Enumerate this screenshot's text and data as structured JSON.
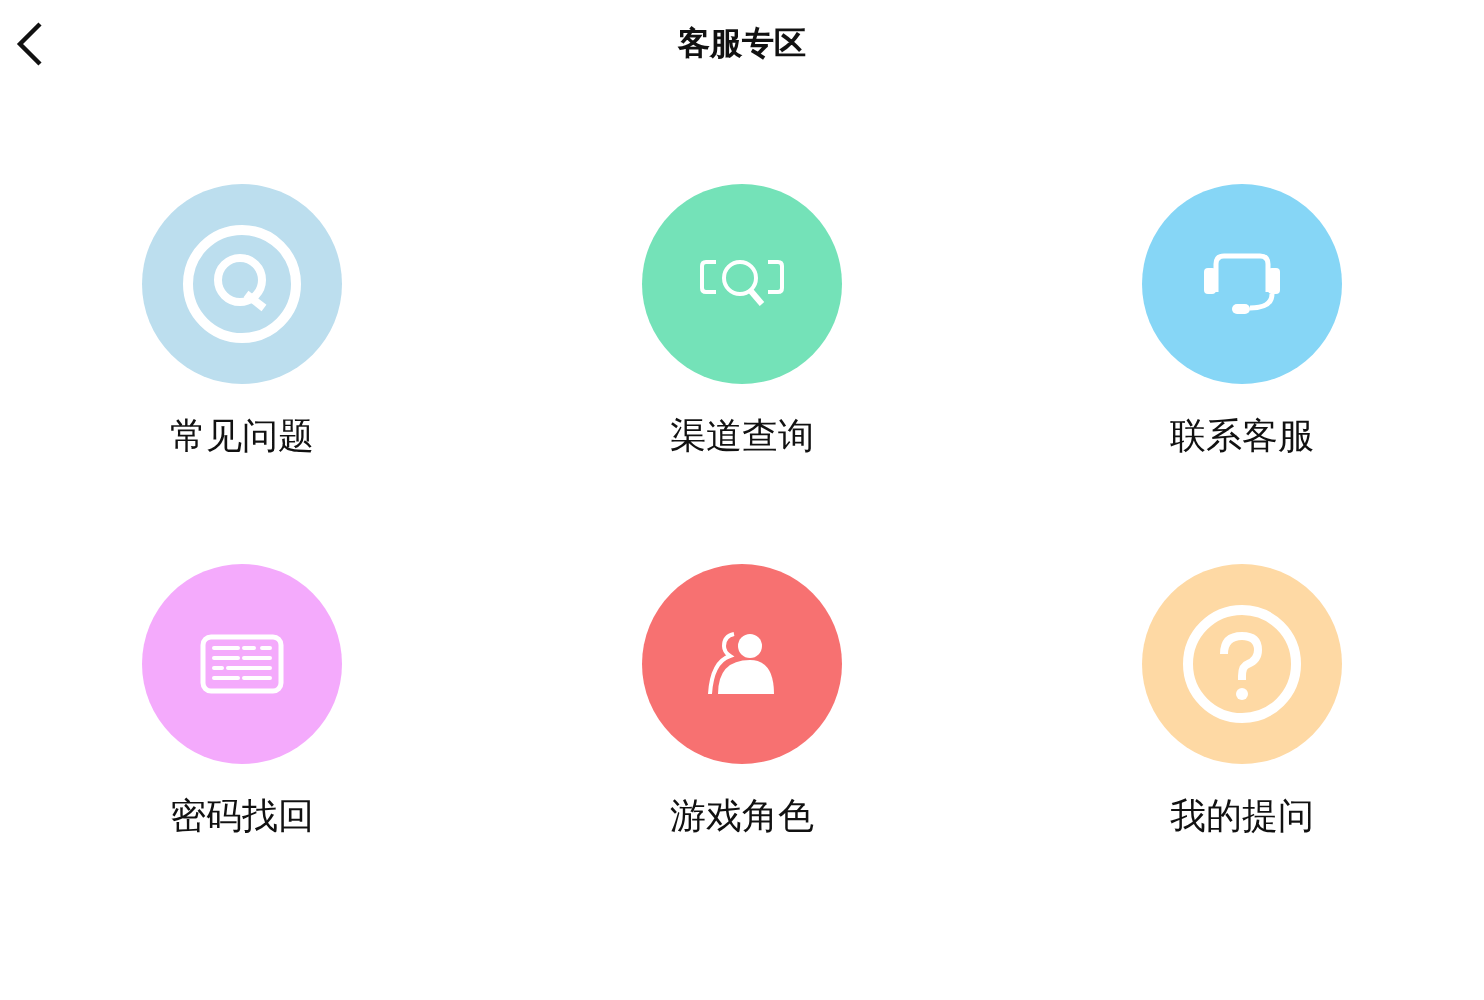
{
  "header": {
    "title": "客服专区"
  },
  "items": [
    {
      "label": "常见问题",
      "kind": "faq",
      "color": "#bcdeee"
    },
    {
      "label": "渠道查询",
      "kind": "search",
      "color": "#74e2b8"
    },
    {
      "label": "联系客服",
      "kind": "headset",
      "color": "#86d6f6"
    },
    {
      "label": "密码找回",
      "kind": "keyboard",
      "color": "#f4aafc"
    },
    {
      "label": "游戏角色",
      "kind": "user",
      "color": "#f77171"
    },
    {
      "label": "我的提问",
      "kind": "question",
      "color": "#fed9a4"
    }
  ]
}
